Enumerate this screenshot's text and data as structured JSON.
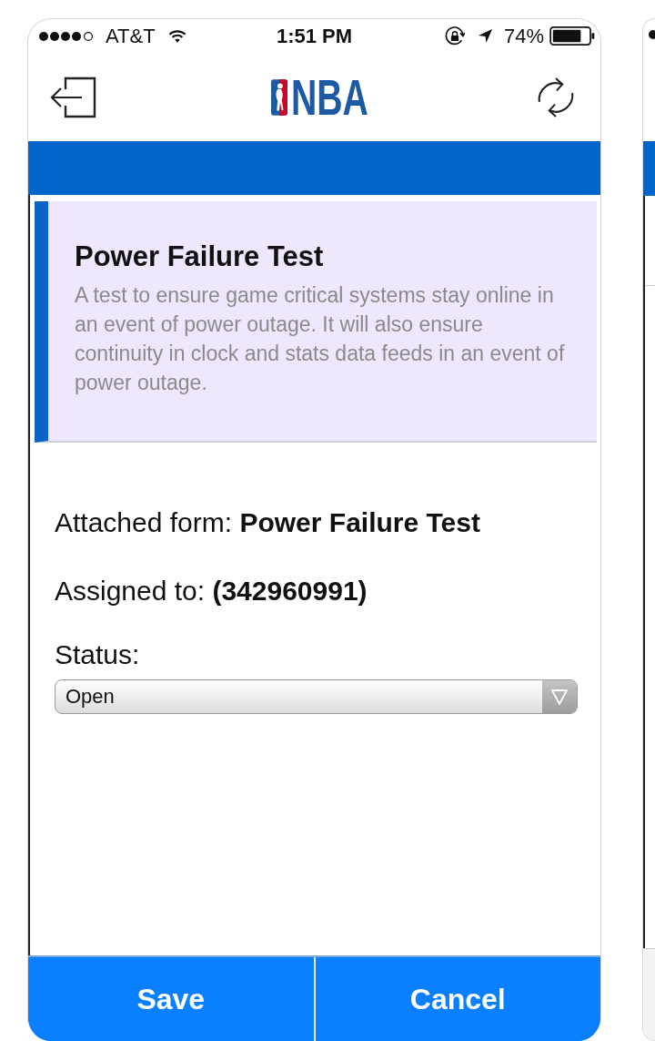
{
  "status_bar": {
    "carrier": "AT&T",
    "time": "1:51 PM",
    "battery_percent": "74%"
  },
  "header": {
    "logo_text": "NBA"
  },
  "card": {
    "title": "Power Failure Test",
    "description": "A test to ensure game critical systems stay online in an event of power outage. It will also ensure continuity in clock and stats data feeds in an event of power outage."
  },
  "details": [
    "Attached form: **Power Failure Test**",
    "Assigned to: **(342960991)**"
  ],
  "status": {
    "label": "Status:",
    "value": "Open"
  },
  "buttons": [
    {
      "label": "Save"
    },
    {
      "label": "Cancel"
    }
  ]
}
